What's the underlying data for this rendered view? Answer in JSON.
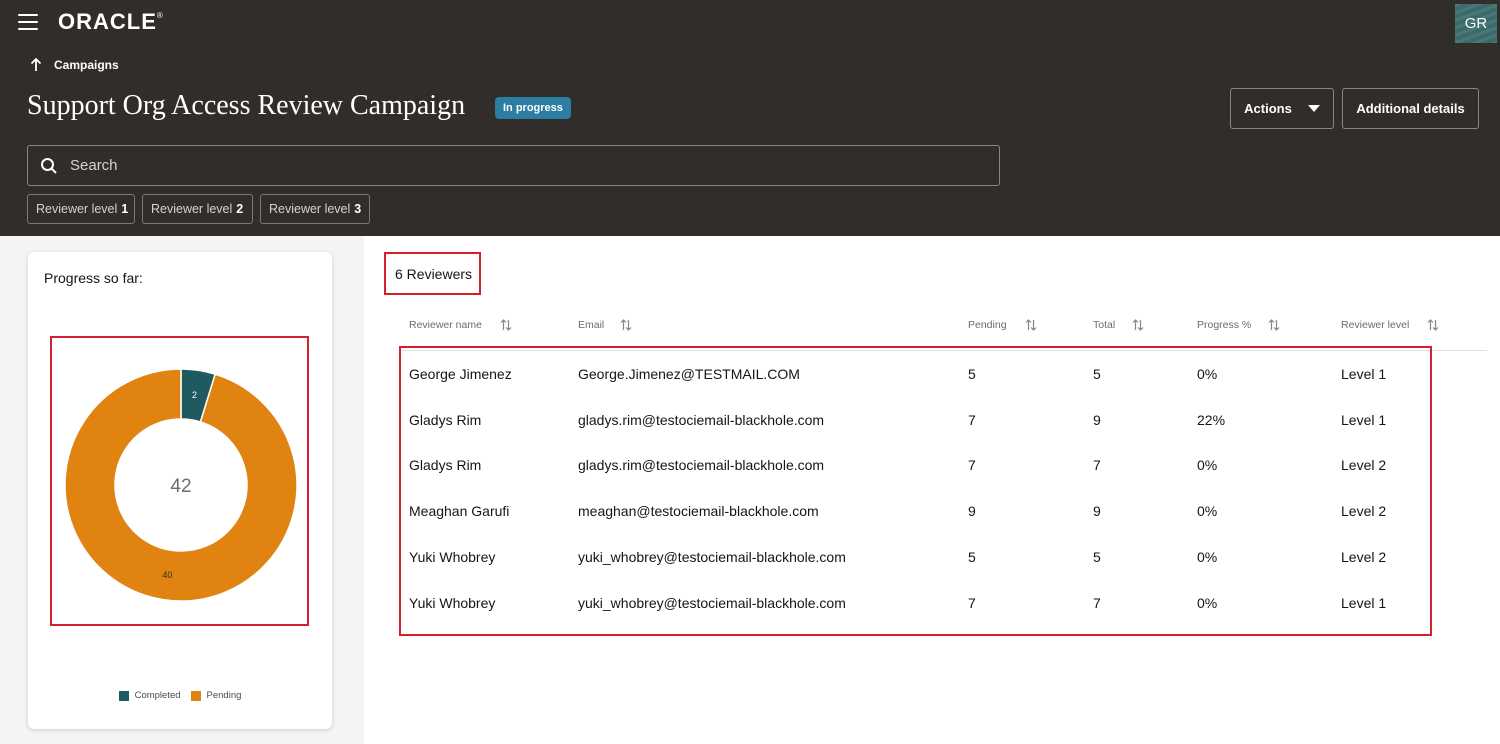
{
  "header": {
    "logo": "ORACLE",
    "logo_mark": "®",
    "avatar_initials": "GR",
    "breadcrumb": "Campaigns",
    "title": "Support Org Access Review Campaign",
    "status_badge": "In progress",
    "actions_label": "Actions",
    "details_label": "Additional details",
    "search_placeholder": "Search",
    "chips": [
      {
        "label": "Reviewer level",
        "value": "1"
      },
      {
        "label": "Reviewer level",
        "value": "2"
      },
      {
        "label": "Reviewer level",
        "value": "3"
      }
    ],
    "colors": {
      "header_bg": "#312d2a",
      "badge_bg": "#2b7ea1"
    }
  },
  "progress_card": {
    "title": "Progress so far:",
    "center_total": "42",
    "legend": [
      {
        "label": "Completed",
        "color": "#1f5a60"
      },
      {
        "label": "Pending",
        "color": "#e08310"
      }
    ]
  },
  "chart_data": {
    "type": "pie",
    "title": "",
    "total": 42,
    "series": [
      {
        "name": "Completed",
        "value": 2,
        "color": "#1f5a60"
      },
      {
        "name": "Pending",
        "value": 40,
        "color": "#e08310"
      }
    ]
  },
  "table": {
    "count_label": "6 Reviewers",
    "columns": [
      "Reviewer name",
      "Email",
      "Pending",
      "Total",
      "Progress %",
      "Reviewer level"
    ],
    "rows": [
      [
        "George Jimenez",
        "George.Jimenez@TESTMAIL.COM",
        "5",
        "5",
        "0%",
        "Level 1"
      ],
      [
        "Gladys Rim",
        "gladys.rim@testociemail-blackhole.com",
        "7",
        "9",
        "22%",
        "Level 1"
      ],
      [
        "Gladys Rim",
        "gladys.rim@testociemail-blackhole.com",
        "7",
        "7",
        "0%",
        "Level 2"
      ],
      [
        "Meaghan Garufi",
        "meaghan@testociemail-blackhole.com",
        "9",
        "9",
        "0%",
        "Level 2"
      ],
      [
        "Yuki Whobrey",
        "yuki_whobrey@testociemail-blackhole.com",
        "5",
        "5",
        "0%",
        "Level 2"
      ],
      [
        "Yuki Whobrey",
        "yuki_whobrey@testociemail-blackhole.com",
        "7",
        "7",
        "0%",
        "Level 1"
      ]
    ]
  }
}
